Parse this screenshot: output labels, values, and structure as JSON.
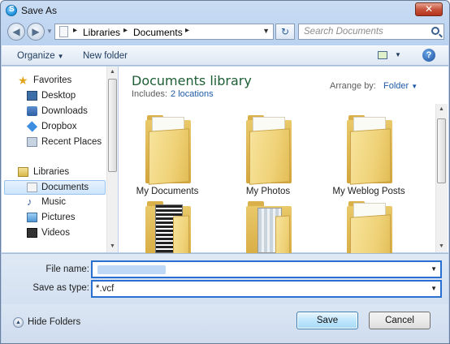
{
  "window": {
    "title": "Save As",
    "close_label": "✕"
  },
  "address": {
    "crumbs": [
      "Libraries",
      "Documents"
    ],
    "separator": "▸",
    "search_placeholder": "Search Documents",
    "refresh_glyph": "↻"
  },
  "toolbar": {
    "organize_label": "Organize",
    "new_folder_label": "New folder",
    "help_glyph": "?"
  },
  "sidebar": {
    "favorites_header": "Favorites",
    "favorites": [
      {
        "label": "Desktop",
        "icon": "desktop-icon"
      },
      {
        "label": "Downloads",
        "icon": "downloads-icon"
      },
      {
        "label": "Dropbox",
        "icon": "dropbox-icon"
      },
      {
        "label": "Recent Places",
        "icon": "recent-places-icon"
      }
    ],
    "libraries_header": "Libraries",
    "libraries": [
      {
        "label": "Documents",
        "icon": "documents-icon",
        "selected": true
      },
      {
        "label": "Music",
        "icon": "music-icon"
      },
      {
        "label": "Pictures",
        "icon": "pictures-icon"
      },
      {
        "label": "Videos",
        "icon": "videos-icon"
      }
    ]
  },
  "main": {
    "library_title": "Documents library",
    "includes_label": "Includes:",
    "includes_link": "2 locations",
    "arrange_label": "Arrange by:",
    "arrange_value": "Folder",
    "folders": [
      {
        "label": "My Documents"
      },
      {
        "label": "My Photos"
      },
      {
        "label": "My Weblog Posts"
      },
      {
        "label": ""
      },
      {
        "label": ""
      },
      {
        "label": ""
      }
    ]
  },
  "form": {
    "filename_label": "File name:",
    "filename_value": "",
    "savetype_label": "Save as type:",
    "savetype_value": "*.vcf"
  },
  "footer": {
    "hide_folders_label": "Hide Folders",
    "save_label": "Save",
    "cancel_label": "Cancel"
  },
  "colors": {
    "library_title": "#1e5e35",
    "link": "#1f5aa6",
    "focus_border": "#2a6fd2"
  }
}
